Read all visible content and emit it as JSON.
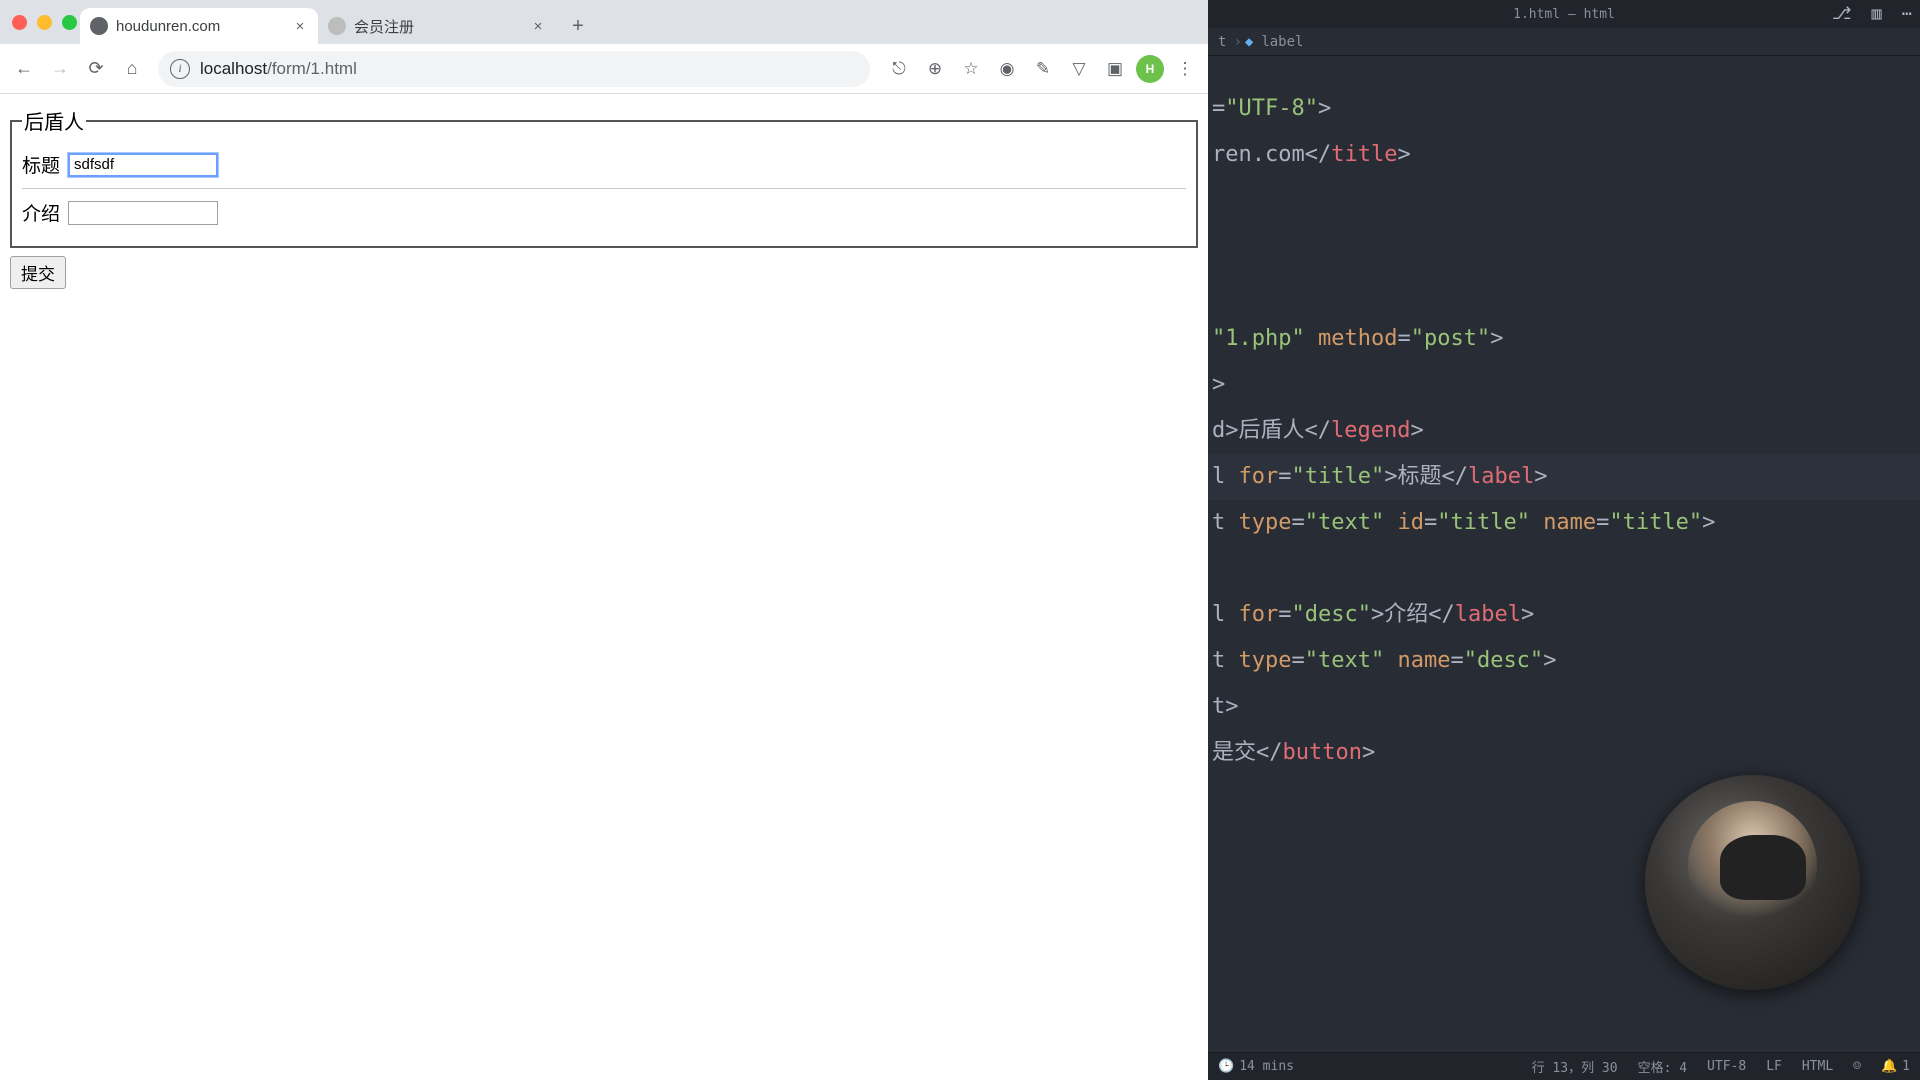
{
  "browser": {
    "tabs": [
      {
        "title": "houdunren.com",
        "active": true
      },
      {
        "title": "会员注册",
        "active": false
      }
    ],
    "url_host": "localhost",
    "url_path": "/form/1.html",
    "profile_initial": "H"
  },
  "page": {
    "legend": "后盾人",
    "title_label": "标题",
    "title_value": "sdfsdf",
    "desc_label": "介绍",
    "desc_value": "",
    "submit_label": "提交"
  },
  "vscode": {
    "window_title": "1.html — html",
    "breadcrumb_tail": "t",
    "breadcrumb_tag": "label",
    "code_lines": [
      {
        "raw": "=\"UTF-8\">"
      },
      {
        "raw": "ren.com</title>"
      },
      {
        "raw": ""
      },
      {
        "raw": ""
      },
      {
        "raw": ""
      },
      {
        "raw": "\"1.php\" method=\"post\">"
      },
      {
        "raw": ">"
      },
      {
        "raw": "d>后盾人</legend>"
      },
      {
        "raw": "l for=\"title\">标题</label>",
        "highlight": true
      },
      {
        "raw": "t type=\"text\" id=\"title\" name=\"title\">"
      },
      {
        "raw": ""
      },
      {
        "raw": "l for=\"desc\">介绍</label>"
      },
      {
        "raw": "t type=\"text\" name=\"desc\">"
      },
      {
        "raw": "t>"
      },
      {
        "raw": "是交</button>"
      }
    ],
    "status": {
      "clock": "14 mins",
      "cursor": "行 13，列 30",
      "spaces": "空格: 4",
      "encoding": "UTF-8",
      "eol": "LF",
      "lang": "HTML",
      "notif": "1"
    }
  }
}
